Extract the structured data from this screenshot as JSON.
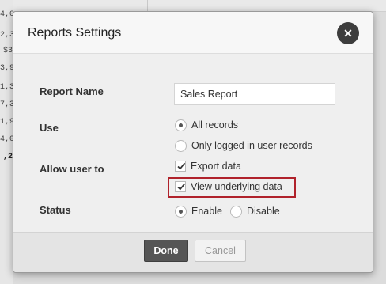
{
  "background": {
    "row_fragments": [
      "4,0",
      "2,3",
      "$3",
      "3,9",
      "1,3",
      "7,3",
      "1,9",
      "4,0",
      ",2"
    ]
  },
  "dialog": {
    "title": "Reports Settings",
    "close_icon": "close-icon",
    "report_name": {
      "label": "Report Name",
      "value": "Sales Report"
    },
    "use": {
      "label": "Use",
      "options": [
        {
          "label": "All records",
          "selected": true
        },
        {
          "label": "Only logged in user records",
          "selected": false
        }
      ]
    },
    "allow_user_to": {
      "label": "Allow user to",
      "options": [
        {
          "label": "Export data",
          "checked": true
        },
        {
          "label": "View underlying data",
          "checked": true
        }
      ]
    },
    "status": {
      "label": "Status",
      "options": [
        {
          "label": "Enable",
          "selected": true
        },
        {
          "label": "Disable",
          "selected": false
        }
      ]
    },
    "buttons": {
      "done": "Done",
      "cancel": "Cancel"
    },
    "highlight_color": "#b0222b"
  }
}
